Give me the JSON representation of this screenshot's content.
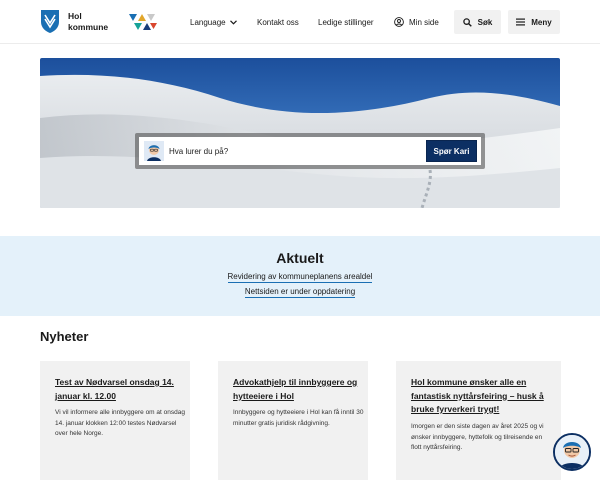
{
  "header": {
    "logo_line1": "Hol",
    "logo_line2": "kommune",
    "nav": {
      "language": "Language",
      "contact": "Kontakt oss",
      "jobs": "Ledige stillinger",
      "my_page": "Min side"
    },
    "search_label": "Søk",
    "menu_label": "Meny"
  },
  "hero": {
    "ask_placeholder": "Hva lurer du på?",
    "ask_button": "Spør Kari"
  },
  "aktuelt": {
    "title": "Aktuelt",
    "links": [
      "Revidering av kommuneplanens arealdel",
      "Nettsiden er under oppdatering"
    ]
  },
  "news": {
    "title": "Nyheter",
    "cards": [
      {
        "title": "Test av Nødvarsel onsdag 14. januar kl. 12.00",
        "text": "Vi vil informere alle innbyggere om at onsdag 14. januar klokken 12:00 testes Nødvarsel over hele Norge."
      },
      {
        "title": "Advokathjelp til innbyggere og hytteeiere i Hol",
        "text": "Innbyggere og hytteeiere i Hol kan få inntil 30 minutter gratis juridisk rådgivning."
      },
      {
        "title": "Hol kommune ønsker alle en fantastisk nyttårsfeiring – husk å bruke fyrverkeri trygt!",
        "text": "Imorgen er den siste dagen av året 2025 og vi ønsker innbyggere, hyttefolk og tilreisende en flott nyttårsfeiring."
      }
    ]
  },
  "colors": {
    "brand_blue": "#0c2f63",
    "aktuelt_bg": "#e4f1fa",
    "card_bg": "#f1f1f1",
    "shield_blue": "#1a6fb3"
  }
}
